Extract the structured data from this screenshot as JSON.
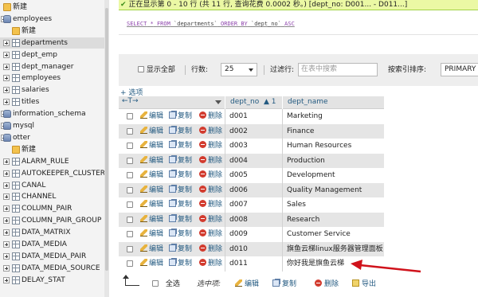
{
  "nav": {
    "items": [
      {
        "label": "新建",
        "icon": "new-icon",
        "kind": "new",
        "level": 0,
        "expander": "none"
      },
      {
        "label": "employees",
        "icon": "database-icon",
        "kind": "db",
        "level": 0,
        "expander": "minus"
      },
      {
        "label": "新建",
        "icon": "new-icon",
        "kind": "new",
        "level": 1,
        "expander": "none"
      },
      {
        "label": "departments",
        "icon": "table-icon",
        "kind": "tbl",
        "level": 1,
        "expander": "plus",
        "selected": true
      },
      {
        "label": "dept_emp",
        "icon": "table-icon",
        "kind": "tbl",
        "level": 1,
        "expander": "plus"
      },
      {
        "label": "dept_manager",
        "icon": "table-icon",
        "kind": "tbl",
        "level": 1,
        "expander": "plus"
      },
      {
        "label": "employees",
        "icon": "table-icon",
        "kind": "tbl",
        "level": 1,
        "expander": "plus"
      },
      {
        "label": "salaries",
        "icon": "table-icon",
        "kind": "tbl",
        "level": 1,
        "expander": "plus"
      },
      {
        "label": "titles",
        "icon": "table-icon",
        "kind": "tbl",
        "level": 1,
        "expander": "plus"
      },
      {
        "label": "information_schema",
        "icon": "database-icon",
        "kind": "db",
        "level": 0,
        "expander": "plus"
      },
      {
        "label": "mysql",
        "icon": "database-icon",
        "kind": "db",
        "level": 0,
        "expander": "plus"
      },
      {
        "label": "otter",
        "icon": "database-icon",
        "kind": "db",
        "level": 0,
        "expander": "minus"
      },
      {
        "label": "新建",
        "icon": "new-icon",
        "kind": "new",
        "level": 1,
        "expander": "none"
      },
      {
        "label": "ALARM_RULE",
        "icon": "table-icon",
        "kind": "tbl",
        "level": 1,
        "expander": "plus"
      },
      {
        "label": "AUTOKEEPER_CLUSTER",
        "icon": "table-icon",
        "kind": "tbl",
        "level": 1,
        "expander": "plus"
      },
      {
        "label": "CANAL",
        "icon": "table-icon",
        "kind": "tbl",
        "level": 1,
        "expander": "plus"
      },
      {
        "label": "CHANNEL",
        "icon": "table-icon",
        "kind": "tbl",
        "level": 1,
        "expander": "plus"
      },
      {
        "label": "COLUMN_PAIR",
        "icon": "table-icon",
        "kind": "tbl",
        "level": 1,
        "expander": "plus"
      },
      {
        "label": "COLUMN_PAIR_GROUP",
        "icon": "table-icon",
        "kind": "tbl",
        "level": 1,
        "expander": "plus"
      },
      {
        "label": "DATA_MATRIX",
        "icon": "table-icon",
        "kind": "tbl",
        "level": 1,
        "expander": "plus"
      },
      {
        "label": "DATA_MEDIA",
        "icon": "table-icon",
        "kind": "tbl",
        "level": 1,
        "expander": "plus"
      },
      {
        "label": "DATA_MEDIA_PAIR",
        "icon": "table-icon",
        "kind": "tbl",
        "level": 1,
        "expander": "plus"
      },
      {
        "label": "DATA_MEDIA_SOURCE",
        "icon": "table-icon",
        "kind": "tbl",
        "level": 1,
        "expander": "plus"
      },
      {
        "label": "DELAY_STAT",
        "icon": "table-icon",
        "kind": "tbl",
        "level": 1,
        "expander": "plus"
      }
    ]
  },
  "message": {
    "icon": "checkmark-icon",
    "text": "正在显示第 0 - 10 行 (共 11 行, 查询花费 0.0002 秒。) [dept_no: D001... - D011...]"
  },
  "sql": {
    "select": "SELECT",
    "star": "*",
    "from": "FROM",
    "table": "`departments`",
    "order_by": "ORDER BY",
    "column": "`dept_no`",
    "direction": "ASC"
  },
  "controls": {
    "show_all_label": "显示全部",
    "rows_label": "行数:",
    "rows_value": "25",
    "filter_label": "过滤行:",
    "filter_placeholder": "在表中搜索",
    "sort_label": "按索引排序:",
    "sort_value": "PRIMARY"
  },
  "options_link": "+ 选项",
  "table": {
    "nav_arrows": "←T→",
    "columns": [
      "dept_no",
      "dept_name"
    ],
    "sort_marker": "1",
    "sort_icon": "sort-ascending-icon",
    "actions": {
      "edit": "编辑",
      "copy": "复制",
      "delete": "删除"
    },
    "rows": [
      {
        "dept_no": "d001",
        "dept_name": "Marketing"
      },
      {
        "dept_no": "d002",
        "dept_name": "Finance"
      },
      {
        "dept_no": "d003",
        "dept_name": "Human Resources"
      },
      {
        "dept_no": "d004",
        "dept_name": "Production"
      },
      {
        "dept_no": "d005",
        "dept_name": "Development"
      },
      {
        "dept_no": "d006",
        "dept_name": "Quality Management"
      },
      {
        "dept_no": "d007",
        "dept_name": "Sales"
      },
      {
        "dept_no": "d008",
        "dept_name": "Research"
      },
      {
        "dept_no": "d009",
        "dept_name": "Customer Service"
      },
      {
        "dept_no": "d010",
        "dept_name": "旗鱼云梯linux服务器管理面板"
      },
      {
        "dept_no": "d011",
        "dept_name": "你好我是旗鱼云梯"
      }
    ]
  },
  "bottom": {
    "select_all": "全选",
    "selected_label": "选中项:",
    "edit": "编辑",
    "copy": "复制",
    "delete": "删除",
    "export": "导出"
  },
  "annotation": {
    "arrow_color": "#d0121b"
  }
}
